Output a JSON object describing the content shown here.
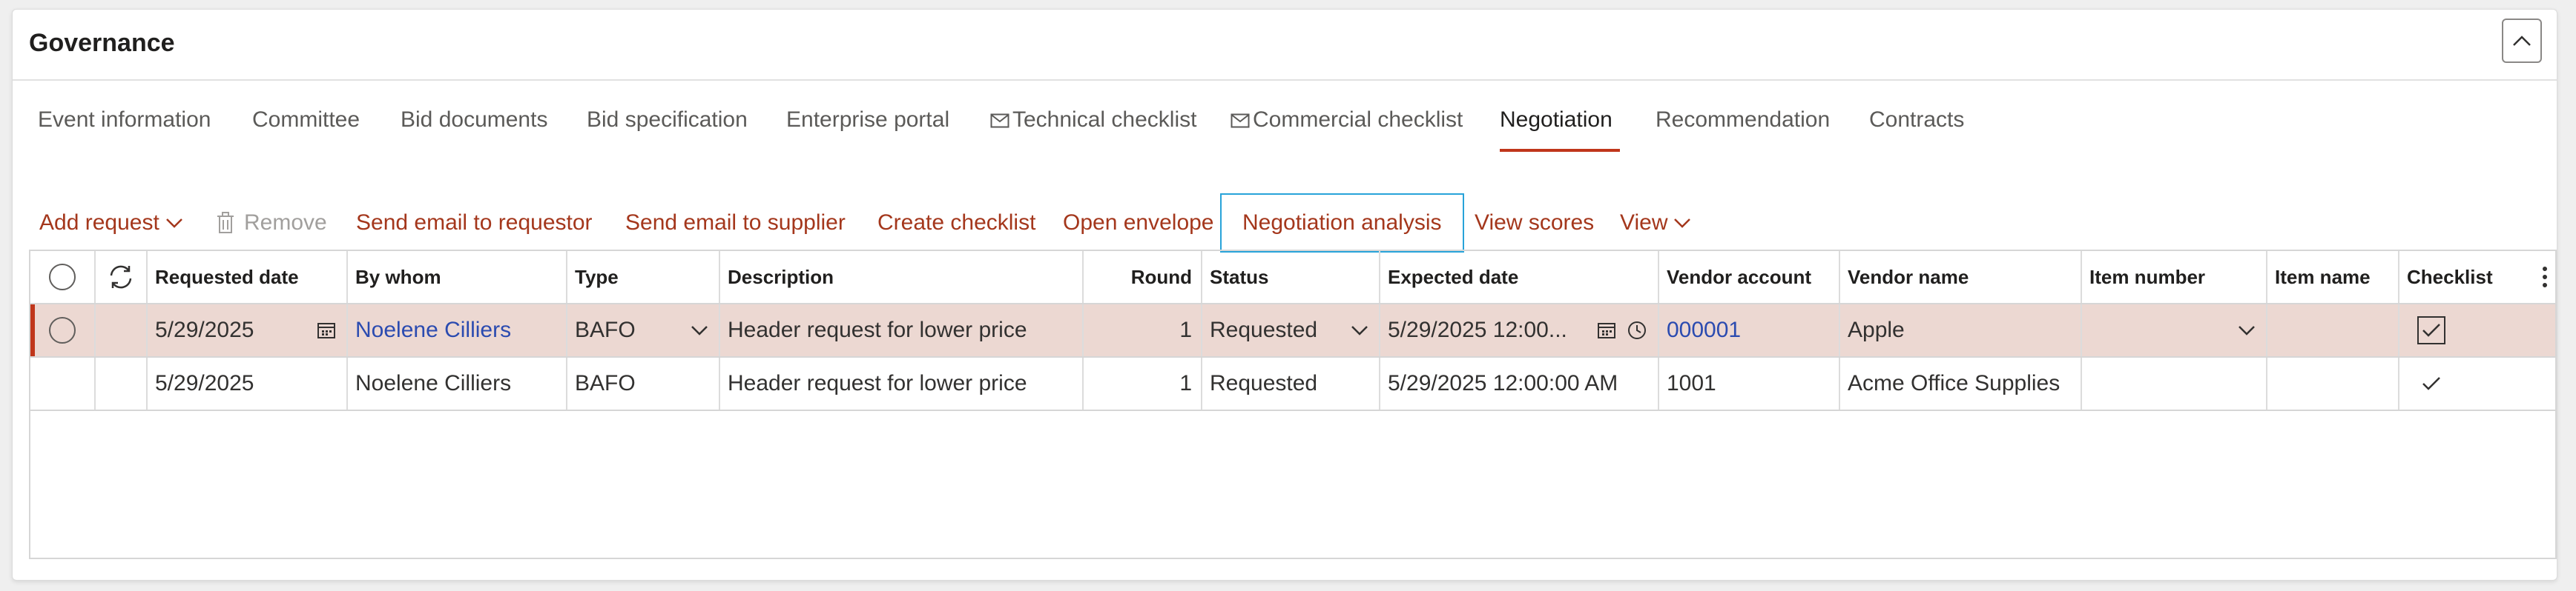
{
  "panel": {
    "title": "Governance"
  },
  "tabs": [
    {
      "label": "Event information"
    },
    {
      "label": "Committee"
    },
    {
      "label": "Bid documents"
    },
    {
      "label": "Bid specification"
    },
    {
      "label": "Enterprise portal"
    },
    {
      "label": "Technical checklist",
      "icon": "mail-icon"
    },
    {
      "label": "Commercial checklist",
      "icon": "mail-icon"
    },
    {
      "label": "Negotiation",
      "active": true
    },
    {
      "label": "Recommendation"
    },
    {
      "label": "Contracts"
    }
  ],
  "toolbar": {
    "add_request": "Add request",
    "remove": "Remove",
    "send_email_requestor": "Send email to requestor",
    "send_email_supplier": "Send email to supplier",
    "create_checklist": "Create checklist",
    "open_envelope": "Open envelope",
    "negotiation_analysis": "Negotiation analysis",
    "view_scores": "View scores",
    "view": "View"
  },
  "grid": {
    "columns": [
      "Requested date",
      "By whom",
      "Type",
      "Description",
      "Round",
      "Status",
      "Expected date",
      "Vendor account",
      "Vendor name",
      "Item number",
      "Item name",
      "Checklist"
    ],
    "rows": [
      {
        "requested_date": "5/29/2025",
        "by_whom": "Noelene Cilliers",
        "type": "BAFO",
        "description": "Header request for lower price",
        "round": "1",
        "status": "Requested",
        "expected_date": "5/29/2025 12:00...",
        "vendor_account": "000001",
        "vendor_name": "Apple",
        "item_number": "",
        "item_name": "",
        "checklist": true
      },
      {
        "requested_date": "5/29/2025",
        "by_whom": "Noelene Cilliers",
        "type": "BAFO",
        "description": "Header request for lower price",
        "round": "1",
        "status": "Requested",
        "expected_date": "5/29/2025 12:00:00 AM",
        "vendor_account": "1001",
        "vendor_name": "Acme Office Supplies",
        "item_number": "",
        "item_name": "",
        "checklist": true
      }
    ]
  },
  "colors": {
    "accent": "#a4371c",
    "active_tab_underline": "#c0361b",
    "selected_row": "#ecd8d2",
    "link": "#2b4bb0",
    "focus": "#28a3d9"
  }
}
